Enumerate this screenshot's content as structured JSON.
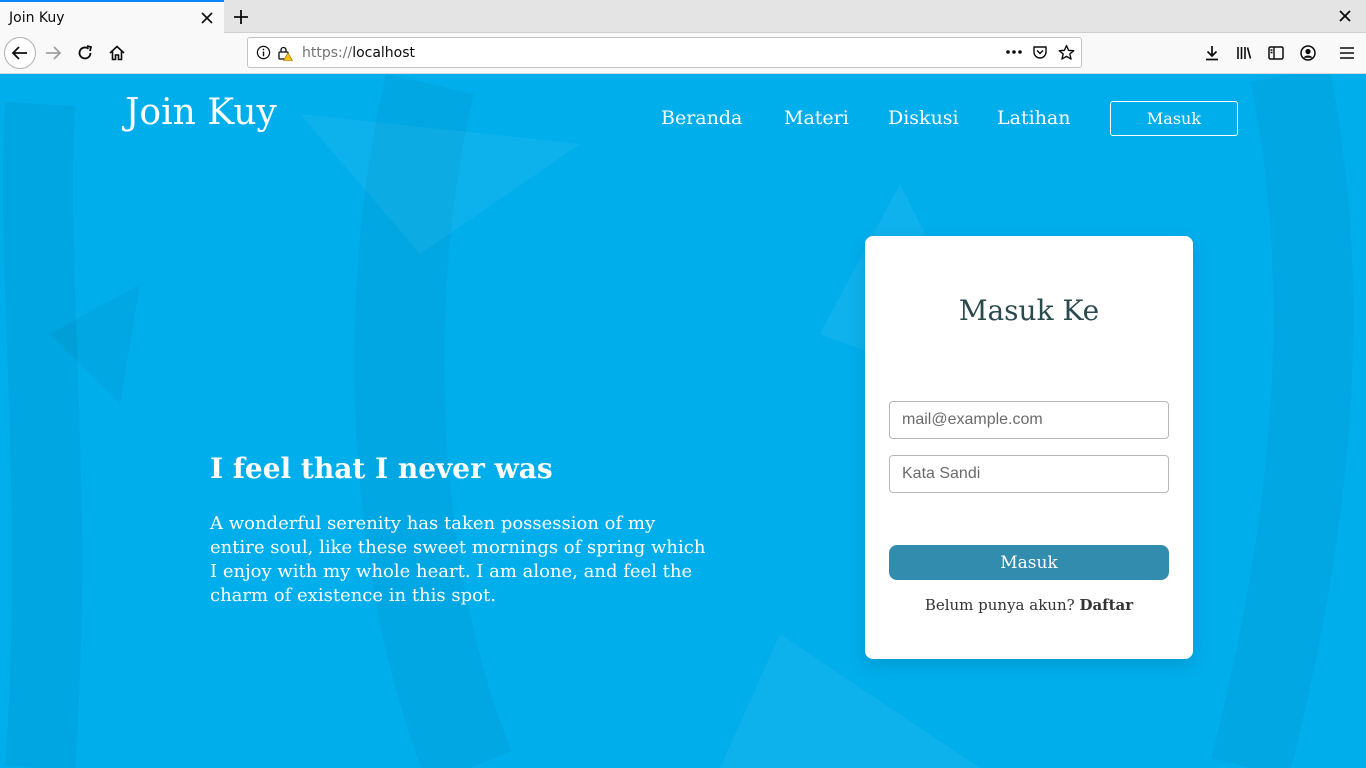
{
  "browser": {
    "tab_title": "Join Kuy",
    "url_scheme": "https://",
    "url_host": "localhost",
    "icons": [
      "close-icon",
      "plus-icon",
      "back-arrow-icon",
      "forward-arrow-icon",
      "reload-icon",
      "home-icon",
      "info-icon",
      "lock-warning-icon",
      "more-icon",
      "pocket-icon",
      "star-icon",
      "download-icon",
      "library-icon",
      "sidebar-icon",
      "account-icon",
      "menu-icon"
    ]
  },
  "site": {
    "brand": "Join Kuy",
    "nav": {
      "home": "Beranda",
      "materials": "Materi",
      "discussion": "Diskusi",
      "practice": "Latihan",
      "login_button": "Masuk"
    },
    "hero": {
      "title": "I feel that I never was",
      "text": "A wonderful serenity has taken possession of my entire soul, like these sweet mornings of spring which I enjoy with my whole heart. I am alone, and feel the charm of existence in this spot."
    },
    "login_card": {
      "title": "Masuk Ke",
      "email_placeholder": "mail@example.com",
      "email_value": "",
      "password_placeholder": "Kata Sandi",
      "password_value": "",
      "submit_label": "Masuk",
      "signup_prompt": "Belum punya akun?",
      "signup_link": "Daftar"
    }
  },
  "colors": {
    "page_background": "#00aeec",
    "card_background": "#ffffff",
    "submit_button": "#318cad",
    "card_title": "#2b4a4e"
  }
}
